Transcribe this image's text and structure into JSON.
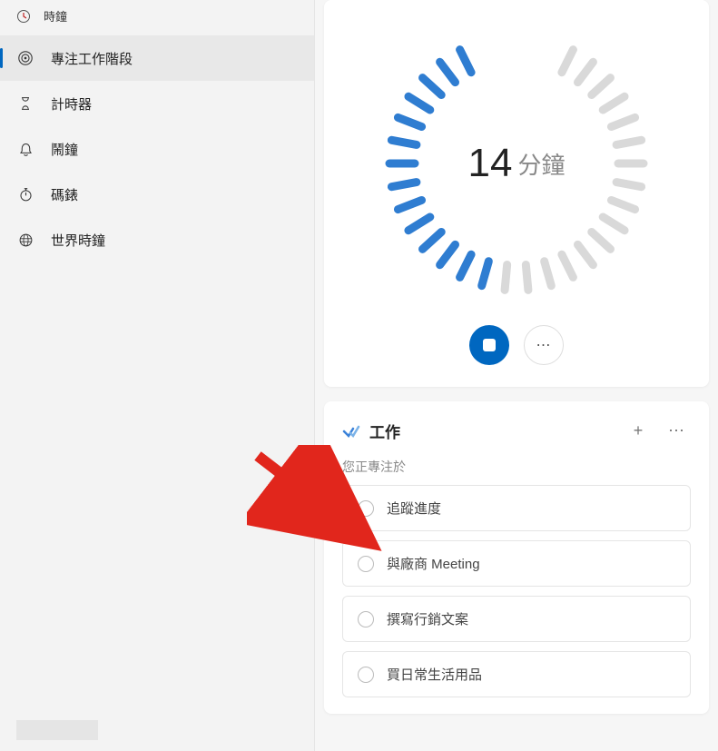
{
  "app": {
    "title": "時鐘"
  },
  "sidebar": {
    "items": [
      {
        "label": "專注工作階段"
      },
      {
        "label": "計時器"
      },
      {
        "label": "鬧鐘"
      },
      {
        "label": "碼錶"
      },
      {
        "label": "世界時鐘"
      }
    ]
  },
  "timer": {
    "value": "14",
    "unit": "分鐘",
    "active_ticks": 14,
    "total_ticks": 30
  },
  "tasks": {
    "title": "工作",
    "subtitle": "您正專注於",
    "items": [
      {
        "label": "追蹤進度"
      },
      {
        "label": "與廠商 Meeting"
      },
      {
        "label": "撰寫行銷文案"
      },
      {
        "label": "買日常生活用品"
      }
    ]
  }
}
